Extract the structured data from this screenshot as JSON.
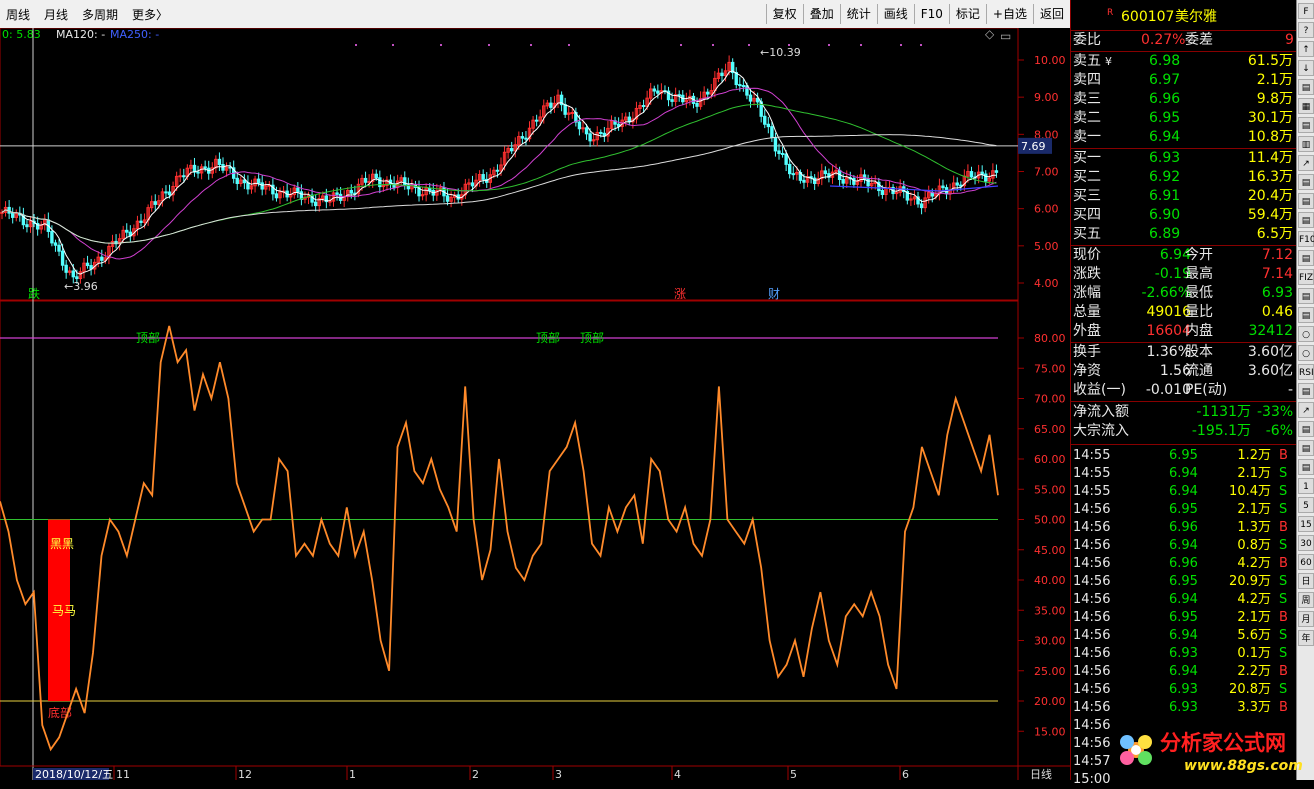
{
  "toolbar": {
    "left": [
      "周线",
      "月线",
      "多周期",
      "更多〉"
    ],
    "right": [
      "复权",
      "叠加",
      "统计",
      "画线",
      "F10",
      "标记",
      "+自选",
      "返回"
    ]
  },
  "ma_legend": {
    "ma0": "0: 5.83",
    "ma120": "MA120: -",
    "ma250": "MA250: -"
  },
  "price_axis": [
    "10.00",
    "9.00",
    "8.00",
    "7.00",
    "6.00",
    "5.00",
    "4.00"
  ],
  "indicator_axis": [
    "80.00",
    "75.00",
    "70.00",
    "65.00",
    "60.00",
    "55.00",
    "50.00",
    "45.00",
    "40.00",
    "35.00",
    "30.00",
    "25.00",
    "20.00",
    "15.00"
  ],
  "crosshair_price": "7.69",
  "annotations": {
    "high": "10.39",
    "low": "3.96",
    "die": "跌",
    "zhang": "涨",
    "cai": "财",
    "top1": "顶部",
    "top2": "顶部",
    "top3": "顶部",
    "black": "黑黑",
    "ma": "马马",
    "bottom": "底部"
  },
  "date_axis": {
    "start": "2018/10/12/五",
    "months": [
      "11",
      "12",
      "1",
      "2",
      "3",
      "4",
      "5",
      "6"
    ],
    "unit": "日线"
  },
  "chart_data": {
    "type": "line",
    "title": "",
    "series": [
      {
        "name": "",
        "values": [
          53,
          48,
          40,
          36,
          38,
          16,
          12,
          14,
          18,
          22,
          18,
          28,
          44,
          50,
          48,
          44,
          50,
          56,
          54,
          76,
          82,
          76,
          78,
          68,
          74,
          70,
          76,
          70,
          56,
          52,
          48,
          50,
          50,
          60,
          58,
          44,
          46,
          44,
          50,
          46,
          44,
          52,
          44,
          48,
          40,
          30,
          25,
          62,
          66,
          58,
          56,
          60,
          55,
          52,
          48,
          72,
          50,
          40,
          45,
          60,
          48,
          42,
          40,
          44,
          46,
          58,
          60,
          62,
          66,
          58,
          46,
          44,
          52,
          48,
          52,
          54,
          46,
          60,
          58,
          50,
          48,
          52,
          46,
          44,
          50,
          72,
          50,
          48,
          46,
          50,
          42,
          30,
          24,
          26,
          30,
          24,
          32,
          38,
          30,
          26,
          34,
          36,
          34,
          38,
          34,
          26,
          22,
          48,
          52,
          62,
          58,
          54,
          64,
          70,
          66,
          62,
          58,
          64,
          54
        ]
      }
    ],
    "ylim": [
      10,
      85
    ]
  },
  "quote": {
    "code": "600107",
    "name": "美尔雅",
    "r_mark": "R",
    "weibi_label": "委比",
    "weibi": "0.27%",
    "weicha_label": "委差",
    "weicha": "9",
    "asks": [
      {
        "label": "卖五",
        "flag": "¥",
        "price": "6.98",
        "vol": "61.5万"
      },
      {
        "label": "卖四",
        "flag": "",
        "price": "6.97",
        "vol": "2.1万"
      },
      {
        "label": "卖三",
        "flag": "",
        "price": "6.96",
        "vol": "9.8万"
      },
      {
        "label": "卖二",
        "flag": "",
        "price": "6.95",
        "vol": "30.1万"
      },
      {
        "label": "卖一",
        "flag": "",
        "price": "6.94",
        "vol": "10.8万"
      }
    ],
    "bids": [
      {
        "label": "买一",
        "price": "6.93",
        "vol": "11.4万"
      },
      {
        "label": "买二",
        "price": "6.92",
        "vol": "16.3万"
      },
      {
        "label": "买三",
        "price": "6.91",
        "vol": "20.4万"
      },
      {
        "label": "买四",
        "price": "6.90",
        "vol": "59.4万"
      },
      {
        "label": "买五",
        "price": "6.89",
        "vol": "6.5万"
      }
    ],
    "stats": [
      {
        "l1": "现价",
        "v1": "6.94",
        "c1": "green",
        "l2": "今开",
        "v2": "7.12",
        "c2": "red"
      },
      {
        "l1": "涨跌",
        "v1": "-0.19",
        "c1": "green",
        "l2": "最高",
        "v2": "7.14",
        "c2": "red"
      },
      {
        "l1": "涨幅",
        "v1": "-2.66%",
        "c1": "green",
        "l2": "最低",
        "v2": "6.93",
        "c2": "green"
      },
      {
        "l1": "总量",
        "v1": "49016",
        "c1": "yellow",
        "l2": "量比",
        "v2": "0.46",
        "c2": "yellow"
      },
      {
        "l1": "外盘",
        "v1": "16604",
        "c1": "red",
        "l2": "内盘",
        "v2": "32412",
        "c2": "green"
      }
    ],
    "stats2": [
      {
        "l1": "换手",
        "v1": "1.36%",
        "l2": "股本",
        "v2": "3.60亿"
      },
      {
        "l1": "净资",
        "v1": "1.56",
        "l2": "流通",
        "v2": "3.60亿"
      },
      {
        "l1": "收益(一)",
        "v1": "-0.010",
        "l2": "PE(动)",
        "v2": "-"
      }
    ],
    "flows": [
      {
        "label": "净流入额",
        "val": "-1131万",
        "pct": "-33%"
      },
      {
        "label": "大宗流入",
        "val": "-195.1万",
        "pct": "-6%"
      }
    ],
    "ticks": [
      {
        "t": "14:55",
        "p": "6.95",
        "v": "1.2万",
        "s": "B"
      },
      {
        "t": "14:55",
        "p": "6.94",
        "v": "2.1万",
        "s": "S"
      },
      {
        "t": "14:55",
        "p": "6.94",
        "v": "10.4万",
        "s": "S"
      },
      {
        "t": "14:56",
        "p": "6.95",
        "v": "2.1万",
        "s": "S"
      },
      {
        "t": "14:56",
        "p": "6.96",
        "v": "1.3万",
        "s": "B"
      },
      {
        "t": "14:56",
        "p": "6.94",
        "v": "0.8万",
        "s": "S"
      },
      {
        "t": "14:56",
        "p": "6.96",
        "v": "4.2万",
        "s": "B"
      },
      {
        "t": "14:56",
        "p": "6.95",
        "v": "20.9万",
        "s": "S"
      },
      {
        "t": "14:56",
        "p": "6.94",
        "v": "4.2万",
        "s": "S"
      },
      {
        "t": "14:56",
        "p": "6.95",
        "v": "2.1万",
        "s": "B"
      },
      {
        "t": "14:56",
        "p": "6.94",
        "v": "5.6万",
        "s": "S"
      },
      {
        "t": "14:56",
        "p": "6.93",
        "v": "0.1万",
        "s": "S"
      },
      {
        "t": "14:56",
        "p": "6.94",
        "v": "2.2万",
        "s": "B"
      },
      {
        "t": "14:56",
        "p": "6.93",
        "v": "20.8万",
        "s": "S"
      },
      {
        "t": "14:56",
        "p": "6.93",
        "v": "3.3万",
        "s": "B"
      },
      {
        "t": "14:56",
        "p": "",
        "v": "",
        "s": ""
      },
      {
        "t": "14:56",
        "p": "",
        "v": "",
        "s": ""
      },
      {
        "t": "14:57",
        "p": "",
        "v": "",
        "s": ""
      },
      {
        "t": "15:00",
        "p": "",
        "v": "",
        "s": ""
      }
    ]
  },
  "icon_bar": [
    "F",
    "?",
    "↑",
    "↓",
    "▤",
    "▦",
    "▤",
    "▥",
    "↗",
    "▤",
    "▤",
    "▤",
    "F10",
    "▤",
    "FIZ",
    "▤",
    "▤",
    "○",
    "○",
    "RSI",
    "▤",
    "↗",
    "▤",
    "▤",
    "▤",
    "1",
    "5",
    "15",
    "30",
    "60",
    "日",
    "周",
    "月",
    "年"
  ],
  "watermark": {
    "cn": "分析家公式网",
    "url": "www.88gs.com"
  },
  "colors": {
    "accent_red": "#ff3030",
    "up": "#ff3030",
    "down": "#00e000",
    "osc": "#ff8a2a",
    "ma_white": "#e8e8e8",
    "ma_magenta": "#d040d0",
    "ma_green": "#30c030",
    "ma_blue": "#4040ff"
  }
}
